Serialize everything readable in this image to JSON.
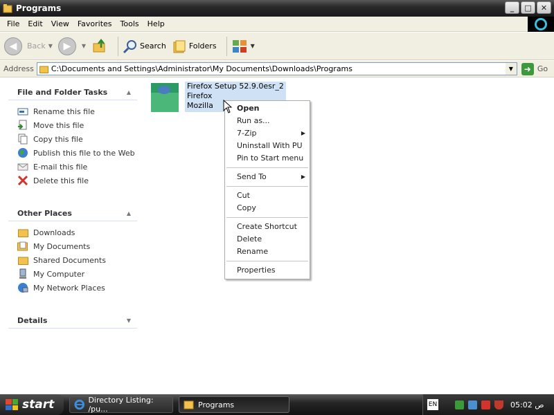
{
  "window": {
    "title": "Programs",
    "buttons": {
      "minimize": "_",
      "maximize": "□",
      "close": "✕"
    }
  },
  "menubar": [
    "File",
    "Edit",
    "View",
    "Favorites",
    "Tools",
    "Help"
  ],
  "toolbar": {
    "back_label": "Back",
    "search_label": "Search",
    "folders_label": "Folders"
  },
  "address": {
    "label": "Address",
    "path": "C:\\Documents and Settings\\Administrator\\My Documents\\Downloads\\Programs",
    "go_label": "Go"
  },
  "left_pane": {
    "file_tasks": {
      "header": "File and Folder Tasks",
      "items": [
        {
          "label": "Rename this file",
          "icon": "rename-icon"
        },
        {
          "label": "Move this file",
          "icon": "move-icon"
        },
        {
          "label": "Copy this file",
          "icon": "copy-icon"
        },
        {
          "label": "Publish this file to the Web",
          "icon": "globe-icon"
        },
        {
          "label": "E-mail this file",
          "icon": "email-icon"
        },
        {
          "label": "Delete this file",
          "icon": "delete-icon"
        }
      ]
    },
    "other_places": {
      "header": "Other Places",
      "items": [
        {
          "label": "Downloads",
          "icon": "folder-icon"
        },
        {
          "label": "My Documents",
          "icon": "my-documents-icon"
        },
        {
          "label": "Shared Documents",
          "icon": "folder-icon"
        },
        {
          "label": "My Computer",
          "icon": "computer-icon"
        },
        {
          "label": "My Network Places",
          "icon": "network-icon"
        }
      ]
    },
    "details": {
      "header": "Details"
    }
  },
  "file": {
    "name": "Firefox Setup 52.9.0esr_2",
    "description": "Firefox",
    "company": "Mozilla"
  },
  "context_menu": {
    "groups": [
      [
        "Open",
        "Run as...",
        "7-Zip",
        "Uninstall With PU",
        "Pin to Start menu"
      ],
      [
        "Send To"
      ],
      [
        "Cut",
        "Copy"
      ],
      [
        "Create Shortcut",
        "Delete",
        "Rename"
      ],
      [
        "Properties"
      ]
    ],
    "submenu_items": [
      "7-Zip",
      "Send To"
    ],
    "default_item": "Open"
  },
  "taskbar": {
    "start_label": "start",
    "tasks": [
      {
        "label": "Directory Listing: /pu...",
        "icon": "internet-explorer-icon"
      },
      {
        "label": "Programs",
        "icon": "folder-icon"
      }
    ],
    "language": "EN",
    "clock": "05:02 ص"
  },
  "colors": {
    "titlebar": "#1a1a1a",
    "chrome": "#f1efe2",
    "selection": "#cfe2f5",
    "taskbar": "#111111"
  }
}
